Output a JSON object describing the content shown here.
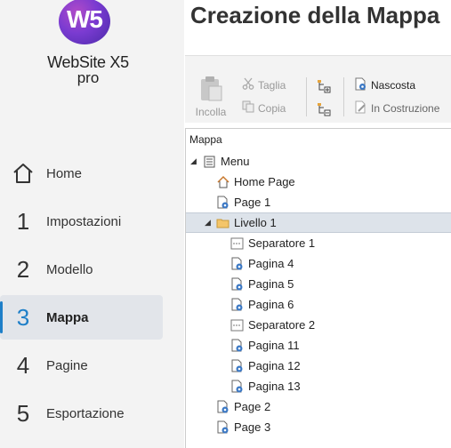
{
  "app": {
    "logo_mark": "W5",
    "logo_name": "WebSite X5",
    "logo_edition": "pro"
  },
  "sidebar": {
    "items": [
      {
        "num": "",
        "icon": "home-icon",
        "label": "Home"
      },
      {
        "num": "1",
        "label": "Impostazioni"
      },
      {
        "num": "2",
        "label": "Modello"
      },
      {
        "num": "3",
        "label": "Mappa",
        "active": true
      },
      {
        "num": "4",
        "label": "Pagine"
      },
      {
        "num": "5",
        "label": "Esportazione"
      }
    ]
  },
  "page": {
    "title": "Creazione della Mappa"
  },
  "toolbar": {
    "paste_label": "Incolla",
    "cut_label": "Taglia",
    "copy_label": "Copia",
    "hidden_label": "Nascosta",
    "construction_label": "In Costruzione"
  },
  "tree": {
    "header": "Mappa",
    "root": "Menu",
    "home": "Home Page",
    "page1": "Page 1",
    "level1": "Livello 1",
    "sep1": "Separatore 1",
    "p4": "Pagina 4",
    "p5": "Pagina 5",
    "p6": "Pagina 6",
    "sep2": "Separatore 2",
    "p11": "Pagina 11",
    "p12": "Pagina 12",
    "p13": "Pagina 13",
    "page2": "Page 2",
    "page3": "Page 3"
  }
}
